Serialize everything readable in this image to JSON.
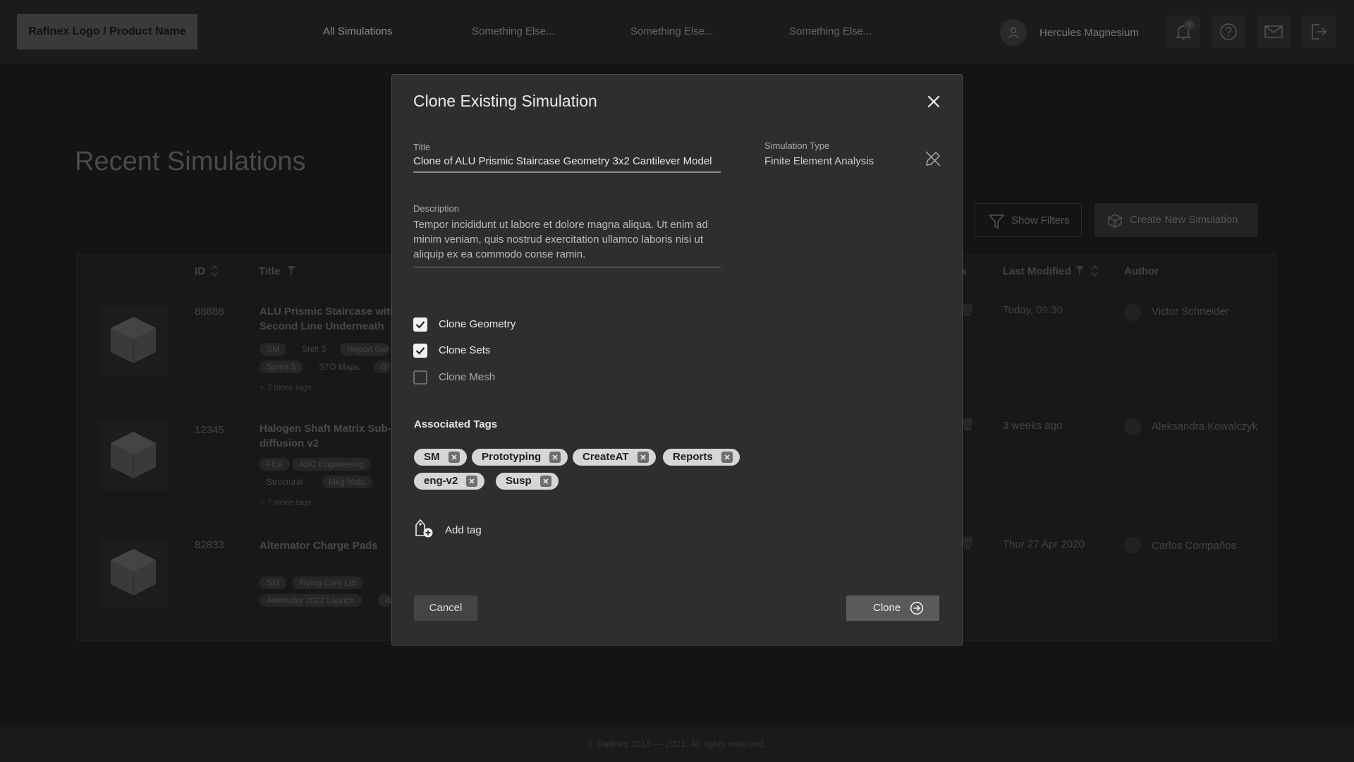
{
  "header": {
    "logo": "Rafinex Logo / Product Name",
    "nav": [
      "All Simulations",
      "Something Else...",
      "Something Else...",
      "Something Else..."
    ],
    "user_name": "Hercules Magnesium",
    "notification_count": "4"
  },
  "page": {
    "title": "Recent Simulations",
    "show_filters": "Show Filters",
    "create_new": "Create New Simulation",
    "columns": {
      "id": "ID",
      "title": "Title",
      "hidden_col_fragment": "s",
      "last_modified": "Last Modified",
      "author": "Author"
    },
    "rows": [
      {
        "id": "88888",
        "title": "ALU Prismic Staircase with Second Line Underneath",
        "tags_line1": [
          "SM",
          "Shift 3",
          "Report Gen"
        ],
        "tags_line2": [
          "Sprint 5",
          "STO Maps",
          "G"
        ],
        "more": "+ 3 more tags",
        "modified_prefix": "Today, ",
        "modified_time": "09:30",
        "author": "Victor Schneider"
      },
      {
        "id": "12345",
        "title": "Halogen Shaft Matrix Sub-diffusion v2",
        "tags_line1": [
          "FEA",
          "ABC Engineering",
          ""
        ],
        "tags_line2": [
          "Structural",
          "Mkg Mats",
          ""
        ],
        "more": "+ 7 more tags",
        "modified": "3 weeks ago",
        "author": "Aleksandra Kowalczyk"
      },
      {
        "id": "82833",
        "title": "Alternator Charge Pads",
        "tags_line1": [
          "SM",
          "Flying Cars Ltd",
          ""
        ],
        "tags_line2": [
          "Alternator 2022 Launch",
          "A"
        ],
        "modified": "Thur 27 Apr 2020",
        "author": "Carlos Compaños"
      }
    ],
    "footer": "© Rafinex 2018 — 2021. All rights reserved."
  },
  "modal": {
    "title": "Clone Existing Simulation",
    "title_label": "Title",
    "title_value": "Clone of ALU Prismic Staircase Geometry 3x2 Cantilever Model",
    "sim_type_label": "Simulation Type",
    "sim_type_value": "Finite Element Analysis",
    "description_label": "Description",
    "description_value": "Tempor incididunt ut labore et dolore magna aliqua. Ut enim ad minim veniam, quis nostrud exercitation ullamco laboris nisi ut aliquip ex ea commodo conse ramin.",
    "options": [
      {
        "label": "Clone Geometry",
        "checked": true
      },
      {
        "label": "Clone Sets",
        "checked": true
      },
      {
        "label": "Clone Mesh",
        "checked": false
      }
    ],
    "tags_title": "Associated Tags",
    "tags": [
      "SM",
      "Prototyping",
      "CreateAT",
      "Reports",
      "eng-v2",
      "Susp"
    ],
    "add_tag": "Add tag",
    "cancel": "Cancel",
    "clone": "Clone"
  }
}
